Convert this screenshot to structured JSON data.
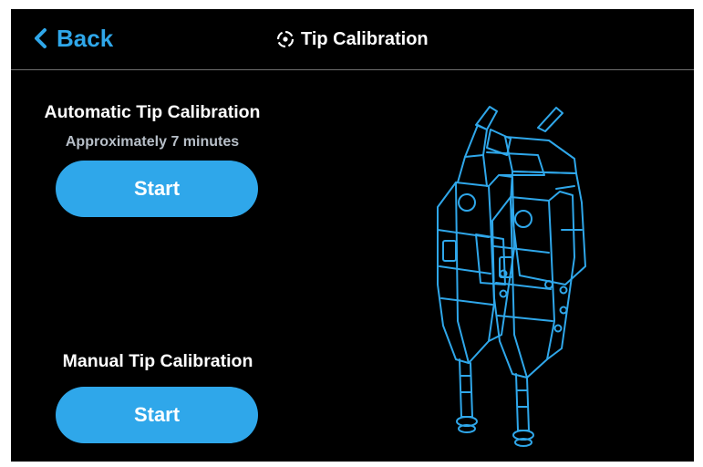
{
  "header": {
    "back_label": "Back",
    "title": "Tip Calibration",
    "title_icon": "crosshair-target-icon"
  },
  "automatic": {
    "title": "Automatic Tip Calibration",
    "subtitle": "Approximately 7 minutes",
    "start_label": "Start"
  },
  "manual": {
    "title": "Manual Tip Calibration",
    "start_label": "Start"
  },
  "illustration": {
    "name": "dual-print-head-icon"
  },
  "colors": {
    "accent": "#2fa7ea",
    "background": "#000000",
    "text": "#ffffff",
    "subtitle": "#b7bfc8",
    "divider": "#6f6f6f"
  }
}
